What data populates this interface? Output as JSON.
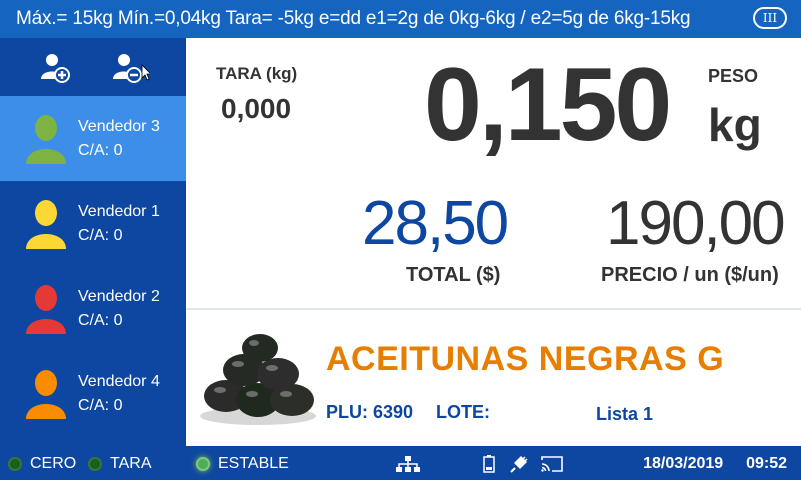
{
  "header": {
    "spec_text": "Máx.= 15kg  Mín.=0,04kg  Tara= -5kg  e=dd  e1=2g de 0kg-6kg / e2=5g de 6kg-15kg",
    "mode_badge": "III"
  },
  "sidebar": {
    "actions": [
      {
        "icon": "add-user-icon"
      },
      {
        "icon": "remove-user-icon"
      }
    ],
    "sellers": [
      {
        "name": "Vendedor 3",
        "ca": "C/A: 0",
        "color": "#7cb342",
        "active": true
      },
      {
        "name": "Vendedor 1",
        "ca": "C/A: 0",
        "color": "#fdd835",
        "active": false
      },
      {
        "name": "Vendedor 2",
        "ca": "C/A: 0",
        "color": "#e53935",
        "active": false
      },
      {
        "name": "Vendedor 4",
        "ca": "C/A: 0",
        "color": "#fb8c00",
        "active": false
      }
    ]
  },
  "weighing": {
    "tara_label": "TARA (kg)",
    "tara_value": "0,000",
    "peso_label": "PESO",
    "peso_value": "0,150",
    "peso_unit": "kg",
    "total_value": "28,50",
    "total_label": "TOTAL ($)",
    "precio_value": "190,00",
    "precio_label": "PRECIO / un ($/un)"
  },
  "product": {
    "name": "ACEITUNAS NEGRAS G",
    "plu": "PLU: 6390",
    "lote": "LOTE:",
    "lista": "Lista 1"
  },
  "statusbar": {
    "cero": "CERO",
    "tara": "TARA",
    "estable": "ESTABLE",
    "icons": [
      "network-icon",
      "battery-icon",
      "plug-icon",
      "cast-icon"
    ],
    "date": "18/03/2019",
    "time": "09:52"
  },
  "colors": {
    "brand_blue": "#0d47a1",
    "active_blue": "#3d8ee8",
    "product_orange": "#e67e00"
  }
}
